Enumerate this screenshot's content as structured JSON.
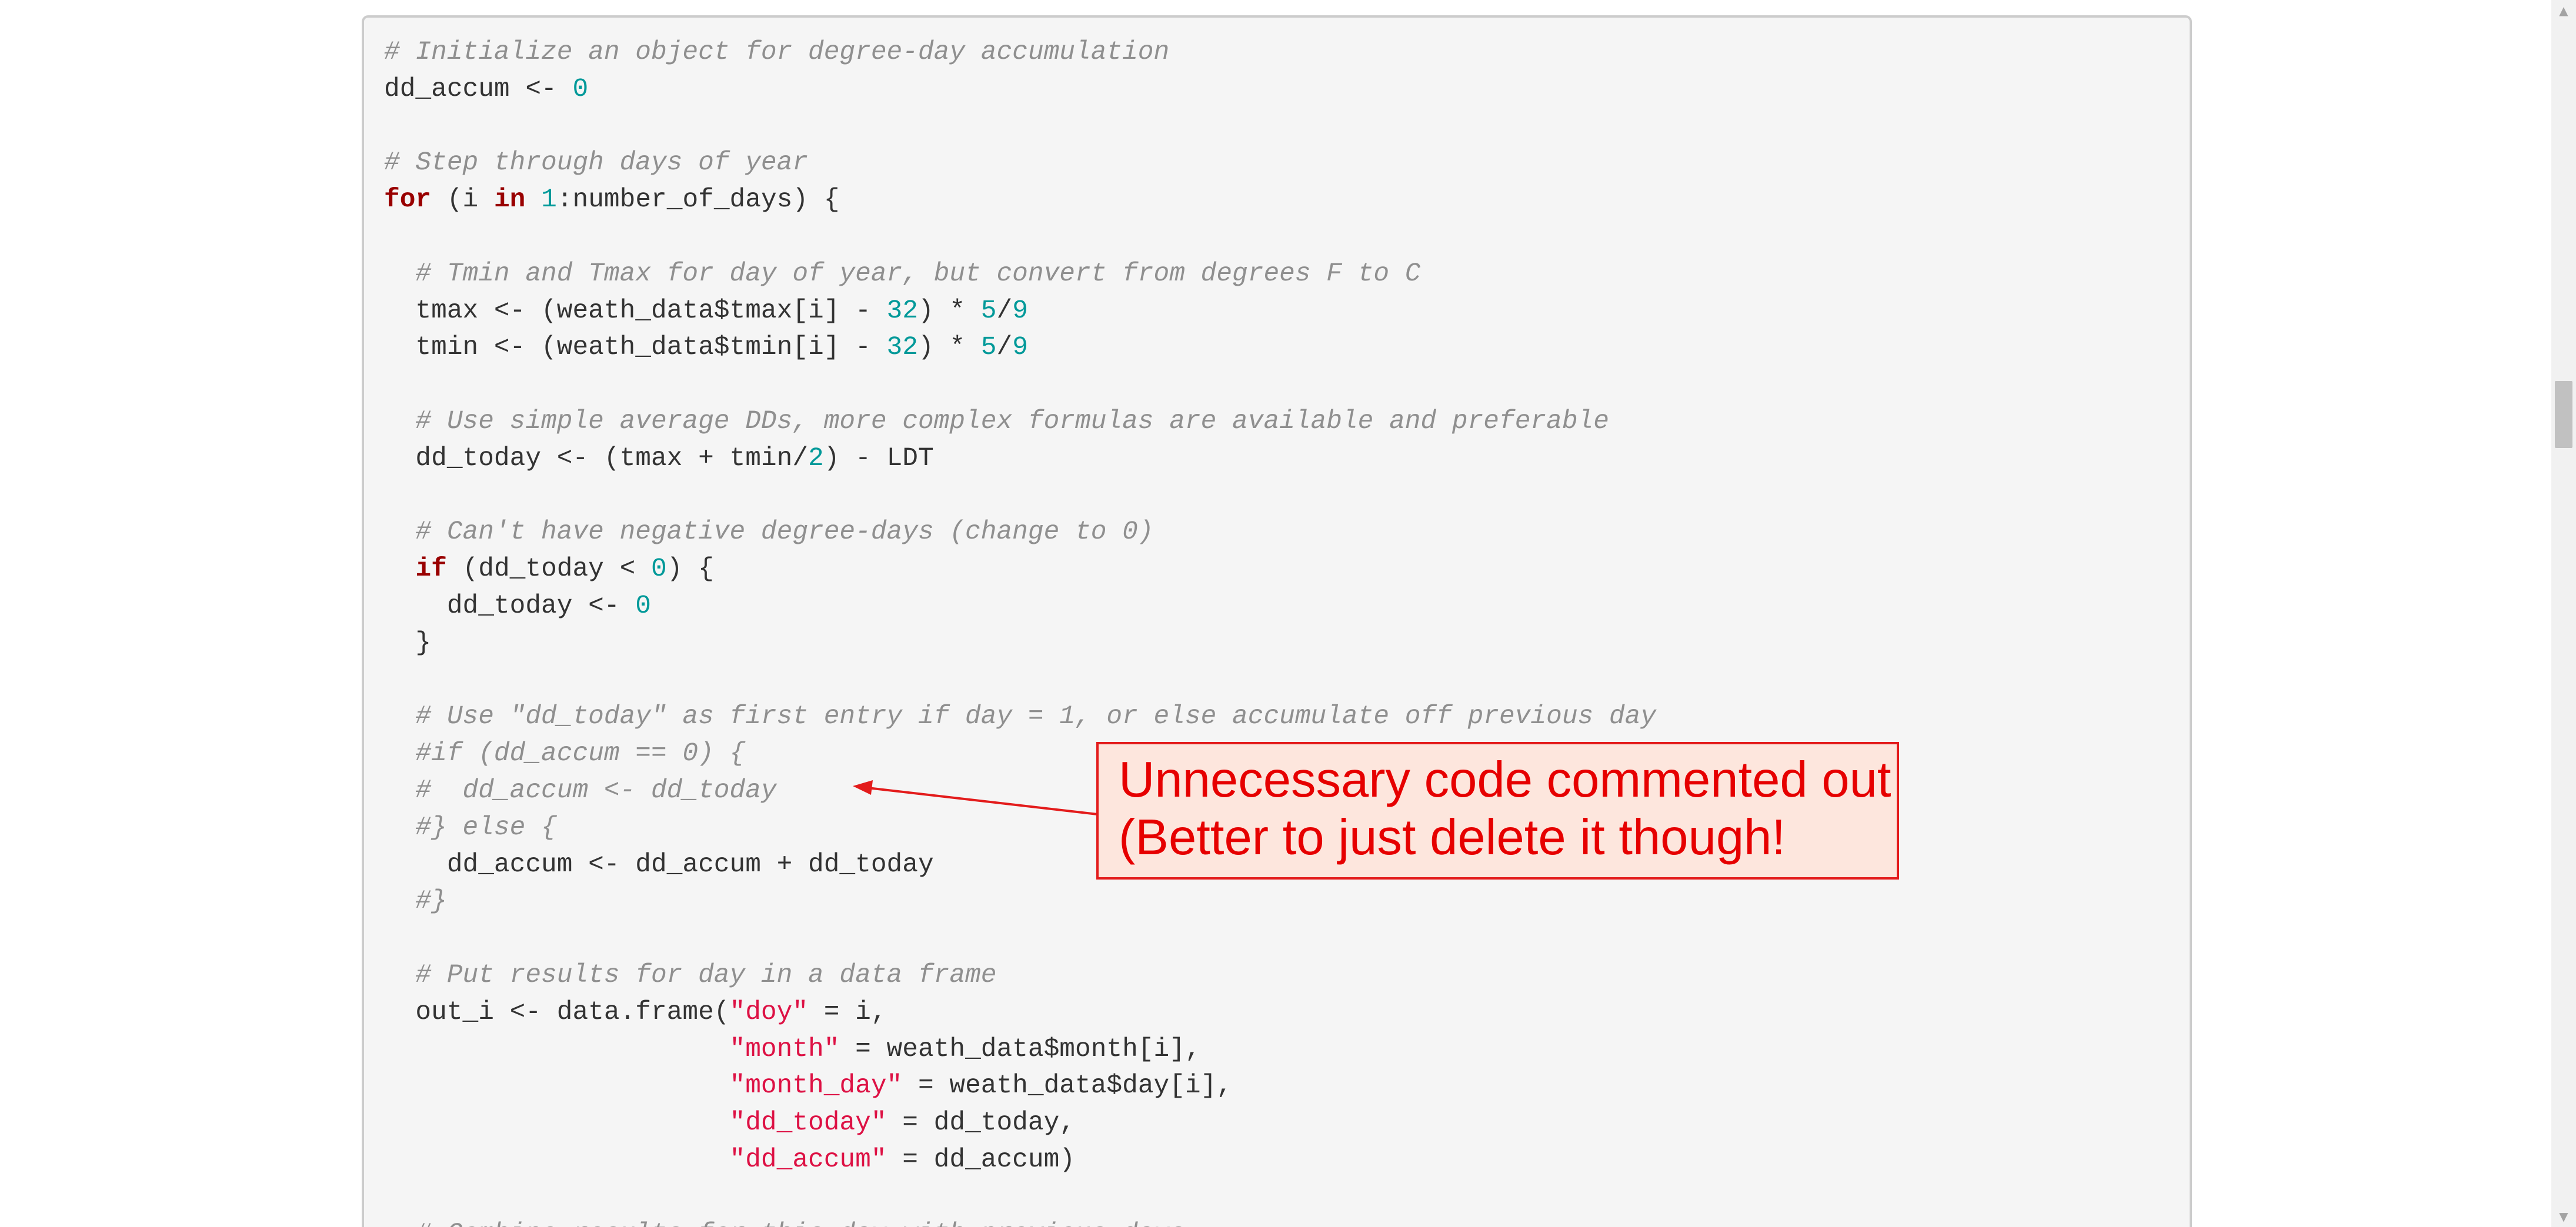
{
  "code_lines": [
    [
      {
        "t": "# Initialize an object for degree-day accumulation",
        "k": "cm"
      }
    ],
    [
      {
        "t": "dd_accum <- ",
        "k": "pl"
      },
      {
        "t": "0",
        "k": "num"
      }
    ],
    [],
    [
      {
        "t": "# Step through days of year",
        "k": "cm"
      }
    ],
    [
      {
        "t": "for",
        "k": "kw"
      },
      {
        "t": " (i ",
        "k": "pl"
      },
      {
        "t": "in",
        "k": "kw"
      },
      {
        "t": " ",
        "k": "pl"
      },
      {
        "t": "1",
        "k": "num"
      },
      {
        "t": ":number_of_days) {",
        "k": "pl"
      }
    ],
    [],
    [
      {
        "t": "  # Tmin and Tmax for day of year, but convert from degrees F to C",
        "k": "cm"
      }
    ],
    [
      {
        "t": "  tmax <- (weath_data$tmax[i] - ",
        "k": "pl"
      },
      {
        "t": "32",
        "k": "num"
      },
      {
        "t": ") * ",
        "k": "pl"
      },
      {
        "t": "5",
        "k": "num"
      },
      {
        "t": "/",
        "k": "pl"
      },
      {
        "t": "9",
        "k": "num"
      }
    ],
    [
      {
        "t": "  tmin <- (weath_data$tmin[i] - ",
        "k": "pl"
      },
      {
        "t": "32",
        "k": "num"
      },
      {
        "t": ") * ",
        "k": "pl"
      },
      {
        "t": "5",
        "k": "num"
      },
      {
        "t": "/",
        "k": "pl"
      },
      {
        "t": "9",
        "k": "num"
      }
    ],
    [],
    [
      {
        "t": "  # Use simple average DDs, more complex formulas are available and preferable",
        "k": "cm"
      }
    ],
    [
      {
        "t": "  dd_today <- (tmax + tmin/",
        "k": "pl"
      },
      {
        "t": "2",
        "k": "num"
      },
      {
        "t": ") - LDT",
        "k": "pl"
      }
    ],
    [],
    [
      {
        "t": "  # Can't have negative degree-days (change to 0)",
        "k": "cm"
      }
    ],
    [
      {
        "t": "  ",
        "k": "pl"
      },
      {
        "t": "if",
        "k": "kw"
      },
      {
        "t": " (dd_today < ",
        "k": "pl"
      },
      {
        "t": "0",
        "k": "num"
      },
      {
        "t": ") {",
        "k": "pl"
      }
    ],
    [
      {
        "t": "    dd_today <- ",
        "k": "pl"
      },
      {
        "t": "0",
        "k": "num"
      }
    ],
    [
      {
        "t": "  }",
        "k": "pl"
      }
    ],
    [],
    [
      {
        "t": "  # Use \"dd_today\" as first entry if day = 1, or else accumulate off previous day",
        "k": "cm"
      }
    ],
    [
      {
        "t": "  #if (dd_accum == 0) {",
        "k": "cm"
      }
    ],
    [
      {
        "t": "  #  dd_accum <- dd_today",
        "k": "cm"
      }
    ],
    [
      {
        "t": "  #} else {",
        "k": "cm"
      }
    ],
    [
      {
        "t": "    dd_accum <- dd_accum + dd_today",
        "k": "pl"
      }
    ],
    [
      {
        "t": "  #}",
        "k": "cm"
      }
    ],
    [],
    [
      {
        "t": "  # Put results for day in a data frame",
        "k": "cm"
      }
    ],
    [
      {
        "t": "  out_i <- data.frame(",
        "k": "pl"
      },
      {
        "t": "\"doy\"",
        "k": "str"
      },
      {
        "t": " = i,",
        "k": "pl"
      }
    ],
    [
      {
        "t": "                      ",
        "k": "pl"
      },
      {
        "t": "\"month\"",
        "k": "str"
      },
      {
        "t": " = weath_data$month[i],",
        "k": "pl"
      }
    ],
    [
      {
        "t": "                      ",
        "k": "pl"
      },
      {
        "t": "\"month_day\"",
        "k": "str"
      },
      {
        "t": " = weath_data$day[i],",
        "k": "pl"
      }
    ],
    [
      {
        "t": "                      ",
        "k": "pl"
      },
      {
        "t": "\"dd_today\"",
        "k": "str"
      },
      {
        "t": " = dd_today,",
        "k": "pl"
      }
    ],
    [
      {
        "t": "                      ",
        "k": "pl"
      },
      {
        "t": "\"dd_accum\"",
        "k": "str"
      },
      {
        "t": " = dd_accum)",
        "k": "pl"
      }
    ],
    [],
    [
      {
        "t": "  # Combine results for this day with previous days",
        "k": "cm"
      }
    ]
  ],
  "callout": {
    "line1": "Unnecessary code commented out",
    "line2": "(Better to just delete it though!"
  },
  "colors": {
    "comment": "#8f8f8f",
    "keyword": "#990000",
    "number": "#009999",
    "string": "#dd1144",
    "plain": "#333333",
    "callout_text": "#e60000",
    "callout_border": "#e31b1b",
    "callout_fill": "#fde6dd"
  },
  "scrollbar": {
    "up_icon": "triangle-up-icon",
    "down_icon": "triangle-down-icon"
  }
}
